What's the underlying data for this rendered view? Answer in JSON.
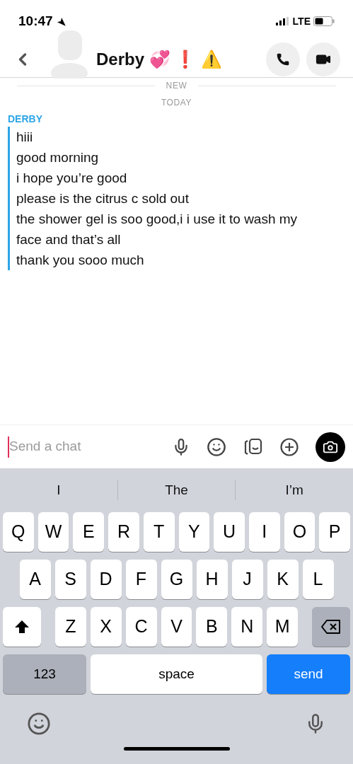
{
  "status_bar": {
    "time": "10:47",
    "network": "LTE"
  },
  "header": {
    "title": "Derby 💞 ❗ ⚠️"
  },
  "dividers": {
    "new": "NEW",
    "day": "TODAY"
  },
  "sender": "DERBY",
  "messages": [
    "hiii",
    "good morning",
    "i hope you’re good",
    "please is the citrus c sold out",
    "the shower gel is soo good,i i use it to wash my face and that’s all",
    "thank you sooo much"
  ],
  "composer": {
    "placeholder": "Send a chat"
  },
  "suggestions": [
    "I",
    "The",
    "I’m"
  ],
  "keyboard": [
    [
      {
        "kind": "letter",
        "label": "Q"
      },
      {
        "kind": "letter",
        "label": "W"
      },
      {
        "kind": "letter",
        "label": "E"
      },
      {
        "kind": "letter",
        "label": "R"
      },
      {
        "kind": "letter",
        "label": "T"
      },
      {
        "kind": "letter",
        "label": "Y"
      },
      {
        "kind": "letter",
        "label": "U"
      },
      {
        "kind": "letter",
        "label": "I"
      },
      {
        "kind": "letter",
        "label": "O"
      },
      {
        "kind": "letter",
        "label": "P"
      }
    ],
    [
      {
        "kind": "letter",
        "label": "A"
      },
      {
        "kind": "letter",
        "label": "S"
      },
      {
        "kind": "letter",
        "label": "D"
      },
      {
        "kind": "letter",
        "label": "F"
      },
      {
        "kind": "letter",
        "label": "G"
      },
      {
        "kind": "letter",
        "label": "H"
      },
      {
        "kind": "letter",
        "label": "J"
      },
      {
        "kind": "letter",
        "label": "K"
      },
      {
        "kind": "letter",
        "label": "L"
      }
    ],
    [
      {
        "kind": "shift"
      },
      {
        "kind": "letter",
        "label": "Z"
      },
      {
        "kind": "letter",
        "label": "X"
      },
      {
        "kind": "letter",
        "label": "C"
      },
      {
        "kind": "letter",
        "label": "V"
      },
      {
        "kind": "letter",
        "label": "B"
      },
      {
        "kind": "letter",
        "label": "N"
      },
      {
        "kind": "letter",
        "label": "M"
      },
      {
        "kind": "backspace"
      }
    ],
    [
      {
        "kind": "numbers",
        "label": "123"
      },
      {
        "kind": "space",
        "label": "space"
      },
      {
        "kind": "send",
        "label": "send"
      }
    ]
  ]
}
